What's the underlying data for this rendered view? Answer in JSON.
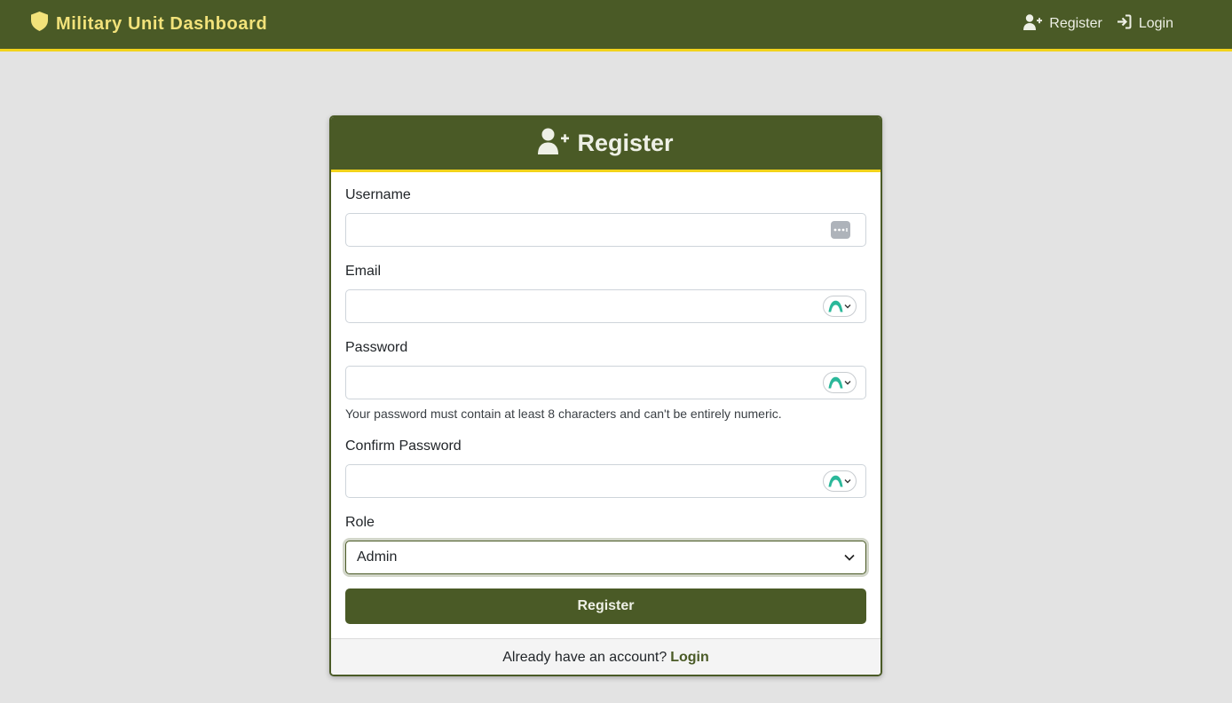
{
  "colors": {
    "primary": "#4a5a26",
    "accent": "#f2d31b",
    "brand_text": "#f2e27a",
    "background": "#e3e3e3"
  },
  "navbar": {
    "brand": {
      "icon": "shield-icon",
      "text": "Military Unit Dashboard"
    },
    "links": [
      {
        "icon": "user-plus-icon",
        "label": "Register"
      },
      {
        "icon": "sign-in-icon",
        "label": "Login"
      }
    ]
  },
  "card": {
    "header": {
      "icon": "user-plus-icon",
      "title": "Register"
    },
    "fields": {
      "username": {
        "label": "Username",
        "value": "",
        "placeholder": ""
      },
      "email": {
        "label": "Email",
        "value": "",
        "placeholder": ""
      },
      "password": {
        "label": "Password",
        "value": "",
        "placeholder": "",
        "help": "Your password must contain at least 8 characters and can't be entirely numeric."
      },
      "confirm_password": {
        "label": "Confirm Password",
        "value": "",
        "placeholder": ""
      },
      "role": {
        "label": "Role",
        "selected": "Admin"
      }
    },
    "submit_label": "Register",
    "footer": {
      "text": "Already have an account?",
      "link": "Login"
    }
  }
}
